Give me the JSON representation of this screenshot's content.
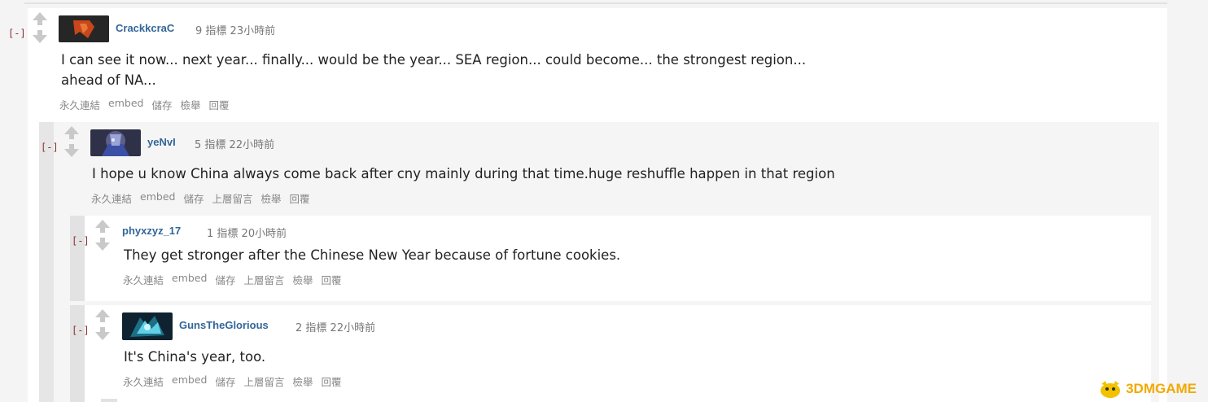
{
  "colors": {
    "accent": "#336699",
    "toggle": "#8b2f2f",
    "arrow": "#c9c9c9",
    "watermark": "#f2a900"
  },
  "comments": [
    {
      "toggle": "[-]",
      "author": "CrackkcraC",
      "points": "9 指標",
      "time": "23小時前",
      "body_lines": [
        "I can see it now... next year... finally... would be the year... SEA region... could become... the strongest region...",
        "ahead of NA..."
      ],
      "actions": [
        "永久連結",
        "embed",
        "儲存",
        "檢舉",
        "回覆"
      ]
    },
    {
      "toggle": "[-]",
      "author": "yeNvI",
      "points": "5 指標",
      "time": "22小時前",
      "body": "I hope u know China always come back after cny mainly during that time.huge reshuffle happen in that region",
      "actions": [
        "永久連結",
        "embed",
        "儲存",
        "上層留言",
        "檢舉",
        "回覆"
      ]
    },
    {
      "toggle": "[-]",
      "author": "phyxzyz_17",
      "points": "1 指標",
      "time": "20小時前",
      "body": "They get stronger after the Chinese New Year because of fortune cookies.",
      "actions": [
        "永久連結",
        "embed",
        "儲存",
        "上層留言",
        "檢舉",
        "回覆"
      ]
    },
    {
      "toggle": "[-]",
      "author": "GunsTheGlorious",
      "points": "2 指標",
      "time": "22小時前",
      "body": "It's China's year, too.",
      "actions": [
        "永久連結",
        "embed",
        "儲存",
        "上層留言",
        "檢舉",
        "回覆"
      ]
    }
  ],
  "watermark": {
    "text": "3DMGAME"
  }
}
